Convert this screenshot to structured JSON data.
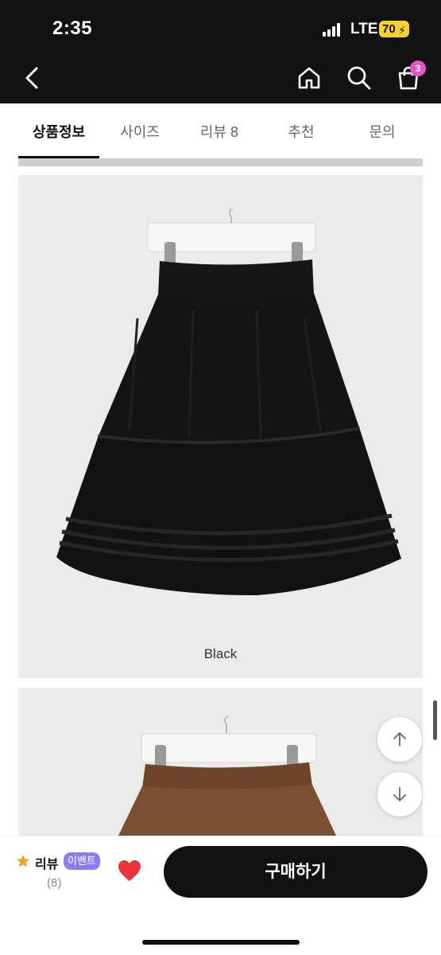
{
  "status": {
    "time": "2:35",
    "network": "LTE",
    "battery": "70"
  },
  "nav": {
    "cart_count": "3"
  },
  "tabs": [
    {
      "label": "상품정보"
    },
    {
      "label": "사이즈"
    },
    {
      "label": "리뷰 8"
    },
    {
      "label": "추천"
    },
    {
      "label": "문의"
    }
  ],
  "product": {
    "image1_caption": "Black"
  },
  "bottom": {
    "review_label": "리뷰",
    "event_badge": "이벤트",
    "review_count": "(8)",
    "buy_label": "구매하기"
  },
  "colors": {
    "header_bg": "#121212",
    "skirt_black": "#141414",
    "skirt_brown": "#7a4f32",
    "heart": "#e8333c",
    "event_badge": "#8c7cf2",
    "cart_badge": "#e455c8",
    "star": "#f0a02c"
  }
}
